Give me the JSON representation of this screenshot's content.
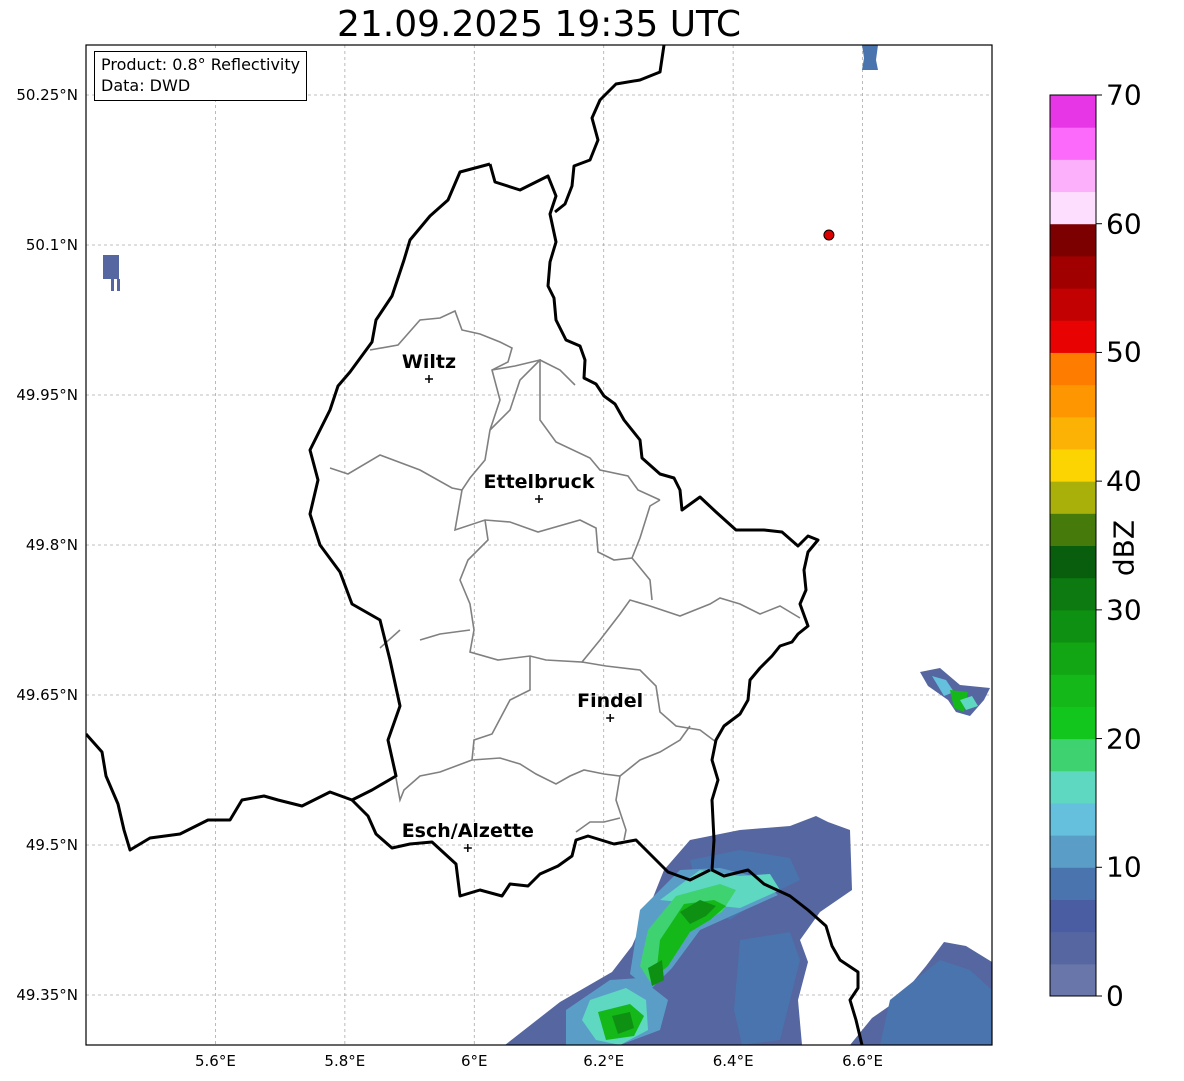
{
  "title": "21.09.2025 19:35 UTC",
  "info": {
    "product": "Product: 0.8° Reflectivity",
    "data": "Data: DWD"
  },
  "lat_ticks": [
    "50.25°N",
    "50.1°N",
    "49.95°N",
    "49.8°N",
    "49.65°N",
    "49.5°N",
    "49.35°N"
  ],
  "lon_ticks": [
    "5.6°E",
    "5.8°E",
    "6°E",
    "6.2°E",
    "6.4°E",
    "6.6°E"
  ],
  "cities": [
    {
      "name": "Wiltz",
      "lon": 5.93,
      "lat": 49.966
    },
    {
      "name": "Ettelbruck",
      "lon": 6.1,
      "lat": 49.846
    },
    {
      "name": "Findel",
      "lon": 6.21,
      "lat": 49.627
    },
    {
      "name": "Esch/Alzette",
      "lon": 5.99,
      "lat": 49.497
    }
  ],
  "radar_marker": {
    "lon": 6.548,
    "lat": 50.11,
    "color": "#dd0000"
  },
  "colorbar": {
    "label": "dBZ",
    "min": 0,
    "max": 70,
    "step": 2.5,
    "ticks": [
      "0",
      "10",
      "20",
      "30",
      "40",
      "50",
      "60",
      "70"
    ],
    "colors": [
      "#6876aa",
      "#5566a0",
      "#4a5da2",
      "#4a74ad",
      "#5a9ec8",
      "#64c0dc",
      "#5fd8c2",
      "#3ed270",
      "#12c61e",
      "#14b818",
      "#12a614",
      "#0e9012",
      "#0c7a10",
      "#085e0c",
      "#467a0a",
      "#aab00a",
      "#fcd402",
      "#fcb204",
      "#fe9602",
      "#fe7c00",
      "#e80202",
      "#c20202",
      "#a00000",
      "#7c0000",
      "#fedefe",
      "#fcb0fc",
      "#fc6afc",
      "#e636e6"
    ]
  },
  "map_extent": {
    "lon_min": 5.4,
    "lon_max": 6.8,
    "lat_min": 49.3,
    "lat_max": 50.3
  }
}
